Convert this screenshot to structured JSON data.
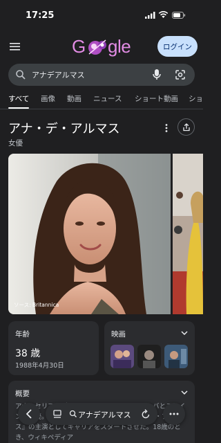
{
  "status_bar": {
    "time": "17:25"
  },
  "header": {
    "logo_text_left": "G",
    "logo_text_right": "gle",
    "login_label": "ログイン"
  },
  "search": {
    "query": "アナデアルマス"
  },
  "tabs": [
    {
      "label": "すべて",
      "active": true
    },
    {
      "label": "画像"
    },
    {
      "label": "動画"
    },
    {
      "label": "ニュース"
    },
    {
      "label": "ショート動画"
    },
    {
      "label": "ショ"
    }
  ],
  "entity": {
    "name": "アナ・デ・アルマス",
    "type": "女優"
  },
  "image_credit": "ソース: Britannica",
  "cards": {
    "age": {
      "label": "年齢",
      "value": "38 歳",
      "date": "1988年4月30日"
    },
    "films": {
      "label": "映画"
    },
    "overview": {
      "label": "概要",
      "text": "アナ・セリア・デ・アルマス・カソは、キューバとスペインの女優。キューバ映画『ロサ・ローサ/ハバナ・ブルース』の主演としてキャリアをスタートさせた。18歳のとき、ウィキペディア"
    }
  },
  "bottom_bar": {
    "query": "アナデアルマス"
  },
  "colors": {
    "background": "#1f1f21",
    "card": "#2b2c2f",
    "login_bg": "#c8e0fc",
    "logo": "#e28ce4"
  }
}
